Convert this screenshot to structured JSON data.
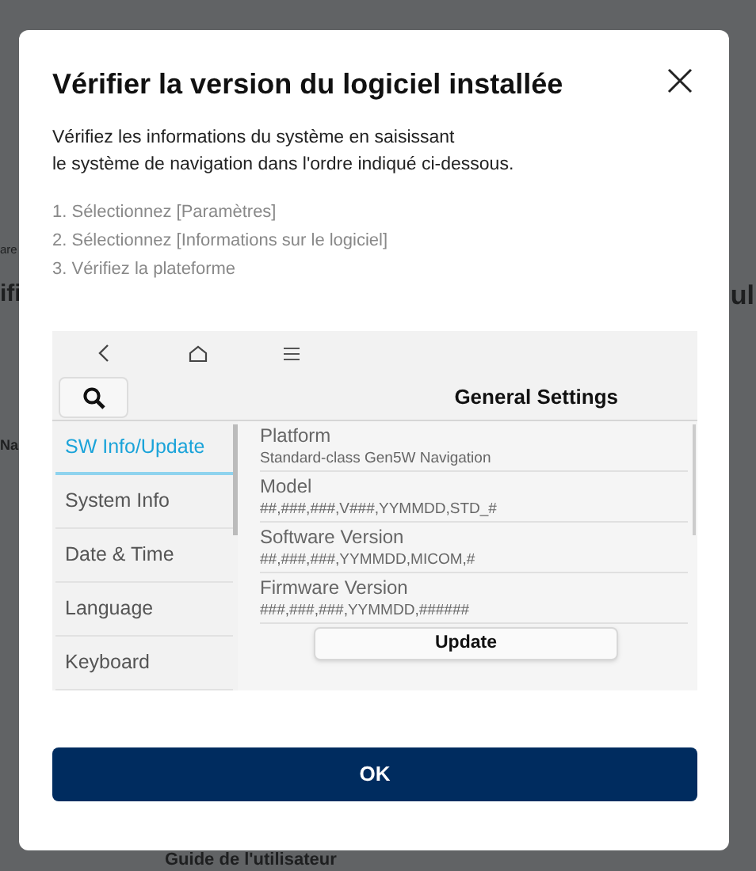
{
  "background": {
    "texts": [
      "are",
      "ifi",
      "ul",
      "Na",
      "Guide de l'utilisateur"
    ]
  },
  "dialog": {
    "title": "Vérifier la version du logiciel installée",
    "description": [
      "Vérifiez les informations du système en saisissant",
      "le système de navigation dans l'ordre indiqué ci-dessous."
    ],
    "steps": [
      "1. Sélectionnez [Paramètres]",
      "2. Sélectionnez [Informations sur le logiciel]",
      "3. Vérifiez la plateforme"
    ],
    "screenshot": {
      "title": "General Settings",
      "menu": [
        {
          "label": "SW Info/Update",
          "selected": true
        },
        {
          "label": "System Info",
          "selected": false
        },
        {
          "label": "Date & Time",
          "selected": false
        },
        {
          "label": "Language",
          "selected": false
        },
        {
          "label": "Keyboard",
          "selected": false
        }
      ],
      "info": [
        {
          "label": "Platform",
          "value": "Standard-class Gen5W Navigation"
        },
        {
          "label": "Model",
          "value": "##,###,###,V###,YYMMDD,STD_#"
        },
        {
          "label": "Software Version",
          "value": "##,###,###,YYMMDD,MICOM,#"
        },
        {
          "label": "Firmware Version",
          "value": "###,###,###,YYMMDD,######"
        }
      ],
      "update_button": "Update"
    },
    "ok_button": "OK"
  }
}
